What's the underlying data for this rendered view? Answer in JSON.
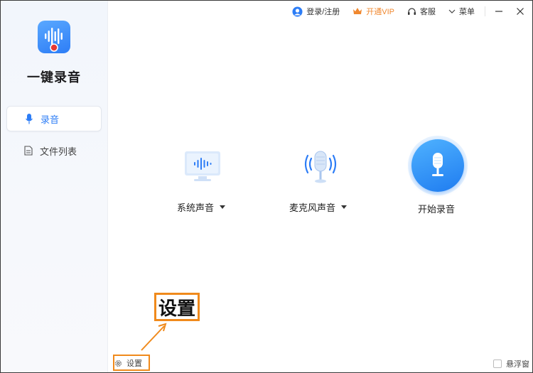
{
  "app": {
    "name": "一键录音"
  },
  "sidebar": {
    "items": [
      {
        "label": "录音",
        "icon": "microphone-icon",
        "active": true
      },
      {
        "label": "文件列表",
        "icon": "document-icon",
        "active": false
      }
    ],
    "settings_label": "设置"
  },
  "topbar": {
    "login_label": "登录/注册",
    "vip_label": "开通VIP",
    "service_label": "客服",
    "menu_label": "菜单"
  },
  "main": {
    "system_audio_label": "系统声音",
    "mic_audio_label": "麦克风声音",
    "start_label": "开始录音"
  },
  "footer": {
    "float_window_label": "悬浮窗"
  },
  "annotation": {
    "callout_text": "设置"
  },
  "colors": {
    "accent": "#2d7df6",
    "vip": "#f0882f",
    "annotation": "#f08a1c"
  }
}
